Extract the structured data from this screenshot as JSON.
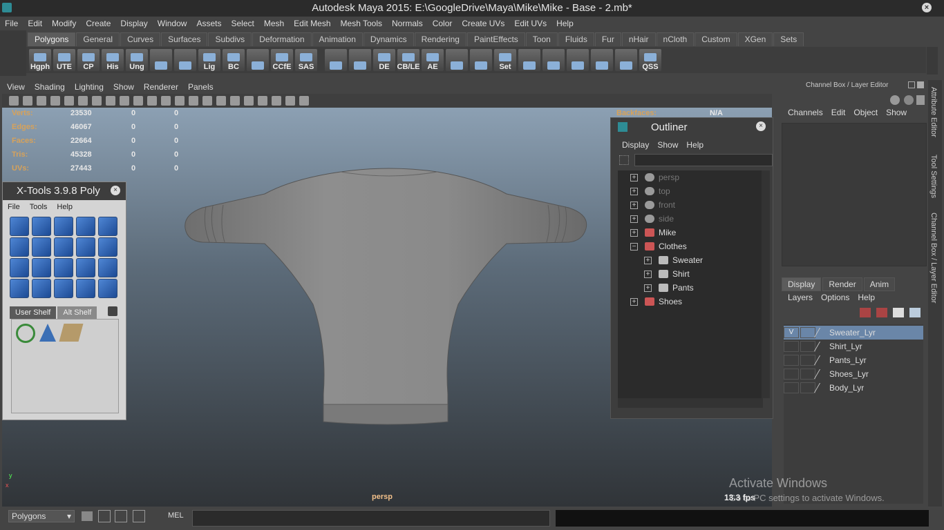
{
  "window": {
    "title": "Autodesk Maya 2015: E:\\GoogleDrive\\Maya\\Mike\\Mike - Base - 2.mb*"
  },
  "menubar": [
    "File",
    "Edit",
    "Modify",
    "Create",
    "Display",
    "Window",
    "Assets",
    "Select",
    "Mesh",
    "Edit Mesh",
    "Mesh Tools",
    "Normals",
    "Color",
    "Create UVs",
    "Edit UVs",
    "Help"
  ],
  "shelf_tabs": [
    "Polygons",
    "General",
    "Curves",
    "Surfaces",
    "Subdivs",
    "Deformation",
    "Animation",
    "Dynamics",
    "Rendering",
    "PaintEffects",
    "Toon",
    "Fluids",
    "Fur",
    "nHair",
    "nCloth",
    "Custom",
    "XGen",
    "Sets"
  ],
  "shelf_tab_active": "Polygons",
  "shelf_buttons": [
    "Hgph",
    "UTE",
    "CP",
    "His",
    "Ung",
    "",
    "",
    "Lig",
    "BC",
    "",
    "CCfE",
    "SAS",
    "",
    "",
    "DE",
    "CB/LE",
    "AE",
    "",
    "",
    "Set",
    "",
    "",
    "",
    "",
    "",
    "QSS"
  ],
  "panel_menu": [
    "View",
    "Shading",
    "Lighting",
    "Show",
    "Renderer",
    "Panels"
  ],
  "hud": {
    "rows": [
      {
        "label": "Verts:",
        "a": "23530",
        "b": "0",
        "c": "0"
      },
      {
        "label": "Edges:",
        "a": "46067",
        "b": "0",
        "c": "0"
      },
      {
        "label": "Faces:",
        "a": "22664",
        "b": "0",
        "c": "0"
      },
      {
        "label": "Tris:",
        "a": "45328",
        "b": "0",
        "c": "0"
      },
      {
        "label": "UVs:",
        "a": "27443",
        "b": "0",
        "c": "0"
      }
    ],
    "backfaces_label": "Backfaces:",
    "backfaces_value": "N/A",
    "camera": "persp",
    "axis_y": "y",
    "axis_x": "x",
    "fps": "13.3 fps"
  },
  "xtools": {
    "title": "X-Tools 3.9.8 Poly",
    "menu": [
      "File",
      "Tools",
      "Help"
    ],
    "tabs": [
      "User Shelf",
      "Alt Shelf"
    ]
  },
  "outliner": {
    "title": "Outliner",
    "menu": [
      "Display",
      "Show",
      "Help"
    ],
    "items": [
      {
        "label": "persp",
        "kind": "camera"
      },
      {
        "label": "top",
        "kind": "camera"
      },
      {
        "label": "front",
        "kind": "camera"
      },
      {
        "label": "side",
        "kind": "camera"
      },
      {
        "label": "Mike",
        "kind": "transform"
      },
      {
        "label": "Clothes",
        "kind": "transform"
      },
      {
        "label": "Sweater",
        "kind": "mesh"
      },
      {
        "label": "Shirt",
        "kind": "mesh"
      },
      {
        "label": "Pants",
        "kind": "mesh"
      },
      {
        "label": "Shoes",
        "kind": "transform"
      }
    ]
  },
  "channel_box": {
    "title": "Channel Box / Layer Editor",
    "menu": [
      "Channels",
      "Edit",
      "Object",
      "Show"
    ],
    "layer_tabs": [
      "Display",
      "Render",
      "Anim"
    ],
    "layer_menu": [
      "Layers",
      "Options",
      "Help"
    ],
    "layers": [
      {
        "name": "Sweater_Lyr",
        "visible": "V",
        "selected": true
      },
      {
        "name": "Shirt_Lyr",
        "visible": "",
        "selected": false
      },
      {
        "name": "Pants_Lyr",
        "visible": "",
        "selected": false
      },
      {
        "name": "Shoes_Lyr",
        "visible": "",
        "selected": false
      },
      {
        "name": "Body_Lyr",
        "visible": "",
        "selected": false
      }
    ]
  },
  "side_tabs": [
    "Attribute Editor",
    "Tool Settings",
    "Channel Box / Layer Editor"
  ],
  "command_line": {
    "mode": "Polygons",
    "lang": "MEL"
  },
  "watermark": {
    "line1": "Activate Windows",
    "line2": "Go to PC settings to activate Windows."
  }
}
